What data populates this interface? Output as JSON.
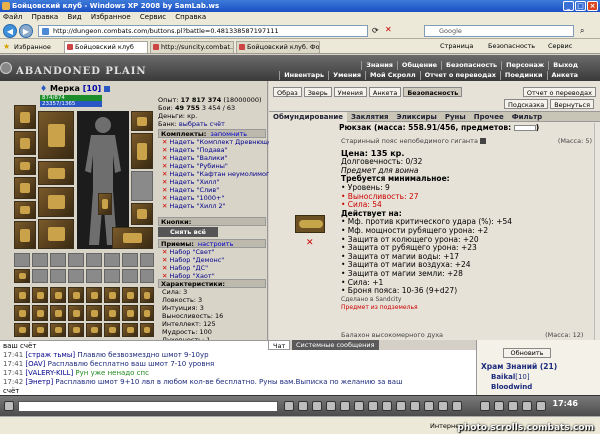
{
  "window": {
    "title": "Бойцовский клуб - Windows XP 2008 by SamLab.ws",
    "min": "_",
    "max": "□",
    "close": "×"
  },
  "menu": [
    "Файл",
    "Правка",
    "Вид",
    "Избранное",
    "Сервис",
    "Справка"
  ],
  "address": {
    "url": "http://dungeon.combats.com/buttons.pl?battle=0.481338587197111",
    "search_placeholder": "Google"
  },
  "tabs": [
    {
      "label": "Избранное"
    },
    {
      "label": "Бойцовский клуб"
    },
    {
      "label": "http://suncity.combat..."
    },
    {
      "label": "Бойцовский клуб. Фо..."
    }
  ],
  "ie_tools": {
    "page": "Страница",
    "security": "Безопасность",
    "tools": "Сервис"
  },
  "game": {
    "logo": "ABANDONED PLAIN",
    "nav1": [
      "Знания",
      "Общение",
      "Безопасность",
      "Персонаж",
      "Выход"
    ],
    "nav2": [
      "Инвентарь",
      "Умения",
      "Мой Скролл",
      "Отчет о переводах",
      "Поединки",
      "Анкета"
    ]
  },
  "character": {
    "name": "Мерка",
    "level": "[10]",
    "hp": "874/874",
    "mp": "23357/1365",
    "stats": [
      {
        "label": "Опыт:",
        "value": "17 817 374",
        "extra": "(18000000)"
      },
      {
        "label": "Бои:",
        "value": "49 755",
        "extra": "3 454 / 63"
      },
      {
        "label": "Деньги:",
        "value": "",
        "extra": "кр."
      },
      {
        "label": "Банк:",
        "value": "",
        "extra": "выбрать счёт"
      }
    ]
  },
  "kits": {
    "header": "Комплекты:",
    "action": "запомнить",
    "items": [
      "Надеть \"Комплект Древнющего Вулкана\"",
      "Надеть \"Подава\"",
      "Надеть \"Валики\"",
      "Надеть \"Рубины\"",
      "Надеть \"Кафтан неумолимого клятвостту\"",
      "Надеть \"Хилл\"",
      "Надеть \"Слив\"",
      "Надеть \"1000+\"",
      "Надеть \"Хилл 2\""
    ]
  },
  "buttons_section": {
    "header": "Кнопки:",
    "remove_all": "Снять всё"
  },
  "tricks": {
    "header": "Приемы:",
    "action": "настроить",
    "items": [
      "Набор \"Свет\"",
      "Набор \"Демонс\"",
      "Набор \"ДС\"",
      "Набор \"Хаот\""
    ]
  },
  "attributes": {
    "header": "Характеристики:",
    "items": [
      "Сила: 3",
      "Ловкость: 3",
      "Интуиция: 3",
      "Выносливость: 16",
      "Интеллект: 125",
      "Мудрость: 100",
      "Духовность: 1"
    ]
  },
  "main": {
    "top_buttons": [
      "Образ",
      "Зверь",
      "Умения",
      "Анкета",
      "Безопасность"
    ],
    "report": "Отчет о переводах",
    "sub_buttons": [
      "Подсказка",
      "Вернуться"
    ],
    "shop_tabs": [
      "Обмундирование",
      "Заклятия",
      "Эликсиры",
      "Руны",
      "Прочее",
      "Фильтр"
    ],
    "backpack": "Рюкзак (масса: 558.91/456, предметов:",
    "backpack_end": ")"
  },
  "item": {
    "name": "Старинный пояс непобедимого гиганта",
    "mass": "(Масса: 5)",
    "price": "Цена: 135 кр.",
    "durability": "Долговечность: 0/32",
    "for_class": "Предмет для воина",
    "req_title": "Требуется минимальное:",
    "reqs": [
      {
        "text": "• Уровень: 9",
        "red": false
      },
      {
        "text": "• Выносливость: 27",
        "red": true
      },
      {
        "text": "• Сила: 54",
        "red": true
      }
    ],
    "acts_title": "Действует на:",
    "acts": [
      "• Мф. против критического удара (%): +54",
      "• Мф. мощности рубящего урона: +2",
      "• Защита от колющего урона: +20",
      "• Защита от рубящего урона: +23",
      "• Защита от магии воды: +17",
      "• Защита от магии воздуха: +24",
      "• Защита от магии земли: +28",
      "• Сила: +1",
      "• Броня пояса: 10-36 (9+d27)"
    ],
    "made_in": "Сделано в Sandcity",
    "not_for_transfer": "Предмет из подземелья",
    "next_item": "Балахон высокомерного духа",
    "next_mass": "(Масса: 12)"
  },
  "chat": {
    "tabs": [
      "Чат",
      "Системные сообщения"
    ],
    "first_line": "ваш счёт",
    "lines": [
      {
        "time": "17:41",
        "nick": "[страж тьмы]",
        "text": "Плавлю безвозмездно шмот 9-10ур",
        "color": "m"
      },
      {
        "time": "17:41",
        "nick": "[OAV]",
        "text": "Расплавлю бесплатно ваш шмот 7-10 уровня",
        "color": "m"
      },
      {
        "time": "17:41",
        "nick": "[VALERY-KILL]",
        "text": "Рун уже ненадо спс",
        "color": "g"
      },
      {
        "time": "17:42",
        "nick": "[Энетр]",
        "text": "Расплавлю шмот 9+10 лвл в любом кол-ве бесплатно. Руны вам.Выписка по желанию за ваш",
        "color": "m"
      }
    ],
    "last_line": "счёт"
  },
  "online": {
    "refresh": "Обновить",
    "room": "Храм Знаний (21)",
    "users": [
      {
        "name": "Baikal",
        "level": "[10]"
      },
      {
        "name": "Bloodwind",
        "level": ""
      }
    ]
  },
  "bottom": {
    "clock": "17:46"
  },
  "status": {
    "zone": "Интернет",
    "watermark": "photo.scrolls.combats.com"
  }
}
